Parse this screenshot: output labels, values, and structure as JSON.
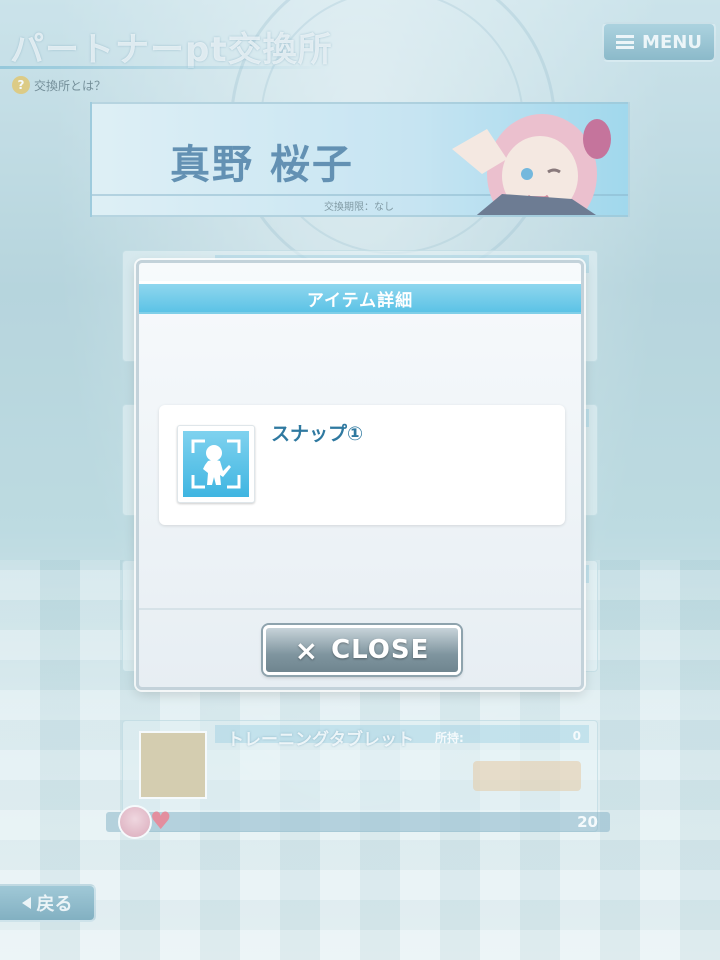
{
  "header": {
    "title": "パートナーpt交換所",
    "menu_label": "MENU",
    "help_label": "交換所とは？",
    "help_icon_glyph": "?"
  },
  "banner": {
    "character_name": "真野 桜子",
    "exchange_limit": "交換期限：なし"
  },
  "list": {
    "last_item": {
      "name": "トレーニングタブレット",
      "owned_label": "所持:",
      "owned_value": "0"
    }
  },
  "points_bar": {
    "value": "20",
    "heart_glyph": "♥"
  },
  "back_button": {
    "label": "戻る"
  },
  "modal": {
    "title": "アイテム詳細",
    "item_name": "スナップ①",
    "item_icon": "snap-figure-icon",
    "close_glyph": "×",
    "close_label": "CLOSE"
  },
  "colors": {
    "accent": "#5cc3e6",
    "item_name": "#2f79a0",
    "close_button": "#7f959f"
  }
}
